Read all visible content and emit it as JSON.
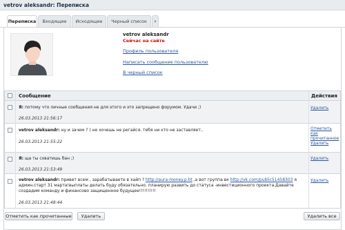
{
  "header": {
    "title": "vetrov aleksandr: Переписка"
  },
  "tabs": [
    {
      "label": "Переписка"
    },
    {
      "label": "Входящие"
    },
    {
      "label": "Исходящие"
    },
    {
      "label": "Черный список"
    }
  ],
  "profile": {
    "name": "vetrov aleksandr",
    "status": "Сейчас на сайте",
    "links": {
      "profile": "Профиль пользователя",
      "write": "Написать сообщение пользователю",
      "blacklist": "В черный список"
    }
  },
  "table": {
    "columns": {
      "message": "Сообщение",
      "actions": "Действия"
    },
    "rows": [
      {
        "author": "Я:",
        "text": " потому что личные сообщения не для этого и это запрещено форумом. Удачи ;)",
        "date": "26.03.2013 21:56:17",
        "actions": [
          "Удалить"
        ]
      },
      {
        "author": "vetrov aleksandr:",
        "text": " ну и зачем ? ) не хочешь не регайся. тебя ни кто не заставляет..",
        "date": "26.03.2013 21:55:22",
        "actions": [
          "Отметить как прочитанное",
          "Удалить"
        ]
      },
      {
        "author": "Я:",
        "text": " ща ты схватишь бан ;)",
        "date": "26.03.2013 21:53:49",
        "actions": [
          "Удалить"
        ]
      },
      {
        "author": "vetrov aleksandr:",
        "text_a": " привет всем , зарабатываете в хайп ? ",
        "link1": "http://aura-money.p.ht",
        "text_b": " ,а вот группа вк ",
        "link2": "http://vk.com/public51458303",
        "text_c": " я админ.старт 31 марта!выплаты делать буду обязательно. планирую развить до статуса -инвестиционного проекта.Давайте создадим команду и финансово защищенное будущее!!!!!!!!!!",
        "date": "26.03.2013 21:48:44",
        "actions": [
          "Удалить"
        ]
      }
    ]
  },
  "buttons": {
    "mark_read": "Отметить как прочитанные",
    "delete": "Удалить",
    "delete_all": "Удалить все"
  }
}
